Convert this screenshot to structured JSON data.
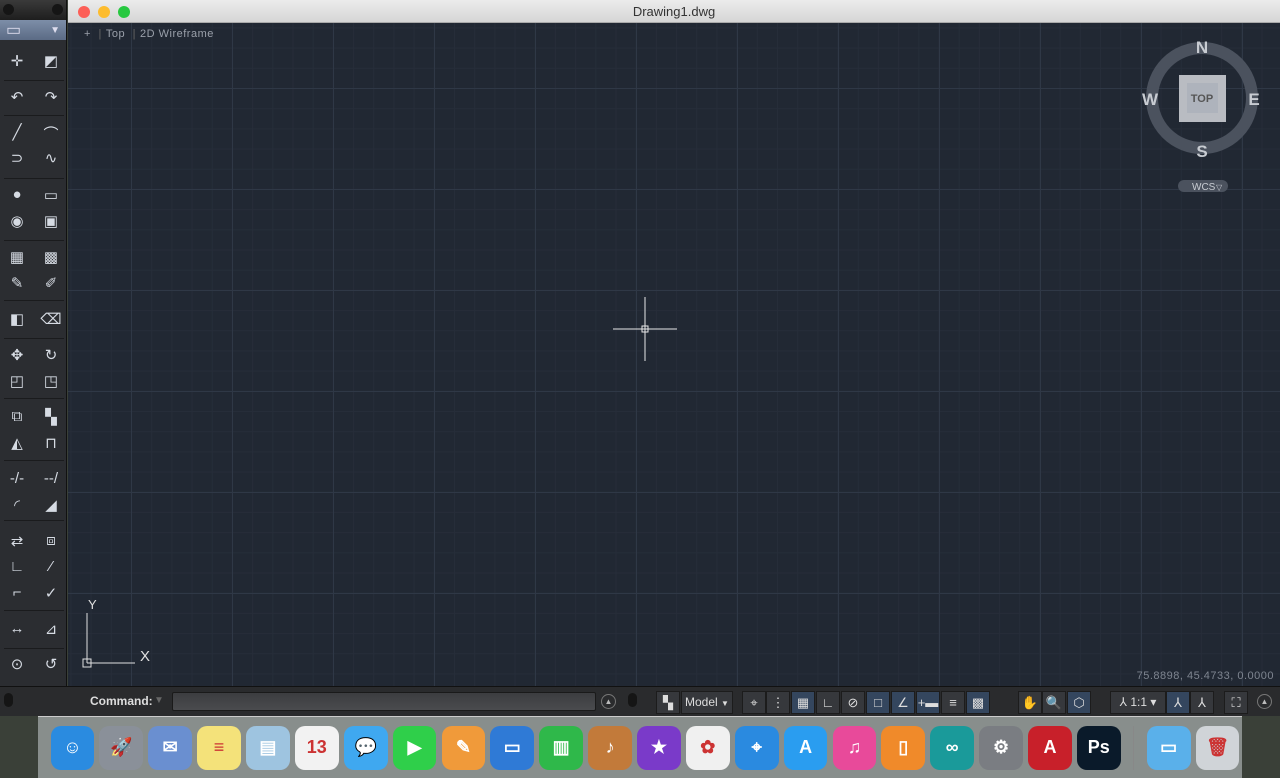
{
  "window": {
    "title": "Drawing1.dwg"
  },
  "viewport": {
    "plus": "+",
    "view": "Top",
    "style": "2D Wireframe",
    "coordinates": "75.8898,  45.4733, 0.0000"
  },
  "viewcube": {
    "n": "N",
    "s": "S",
    "e": "E",
    "w": "W",
    "face": "TOP",
    "ucs": "WCS"
  },
  "ucs_icon": {
    "x": "X",
    "y": "Y"
  },
  "toolbar": {
    "rows": [
      [
        "crosshair-point-icon",
        "✛",
        "region-icon",
        "◩"
      ],
      [
        "undo-icon",
        "↶",
        "redo-icon",
        "↷"
      ],
      [
        "line-icon",
        "╱",
        "arc-icon",
        "⌒"
      ],
      [
        "polyline-icon",
        "⊃",
        "spline-icon",
        "∿"
      ],
      [
        "circle-icon",
        "●",
        "rectangle-icon",
        "▭"
      ],
      [
        "ellipse-icon",
        "◉",
        "boundary-icon",
        "▣"
      ],
      [
        "hatch-icon",
        "▦",
        "gradient-icon",
        "▩"
      ],
      [
        "pen-icon",
        "✎",
        "brush-icon",
        "✐"
      ],
      [
        "block-icon",
        "◧",
        "erase-icon",
        "⌫"
      ],
      [
        "move-icon",
        "✥",
        "rotate-icon",
        "↻"
      ],
      [
        "scale-icon",
        "◰",
        "stretch-icon",
        "◳"
      ],
      [
        "copy-icon",
        "⧉",
        "array-icon",
        "▚"
      ],
      [
        "mirror-icon",
        "◭",
        "offset-icon",
        "⊓"
      ],
      [
        "trim-icon",
        "-/-",
        "extend-icon",
        "--/"
      ],
      [
        "fillet-icon",
        "◜",
        "chamfer-icon",
        "◢"
      ],
      [
        "explode-icon",
        "⇄",
        "join-icon",
        "⧈"
      ],
      [
        "break-icon",
        "∟",
        "lengthen-icon",
        "⁄"
      ],
      [
        "align-icon",
        "⌐",
        "properties-icon",
        "✓"
      ],
      [
        "dimension-icon",
        "↔",
        "leader-icon",
        "⊿"
      ],
      [
        "measure-icon",
        "⊙",
        "inquiry-icon",
        "↺"
      ]
    ]
  },
  "status": {
    "command_label": "Command:",
    "command_value": "",
    "model_label": "Model",
    "scale_label": "1:1"
  },
  "dock": [
    {
      "name": "finder",
      "color": "#2a8be0",
      "glyph": "☺"
    },
    {
      "name": "launchpad",
      "color": "#8a9099",
      "glyph": "🚀"
    },
    {
      "name": "mail",
      "color": "#6a8fd0",
      "glyph": "✉"
    },
    {
      "name": "notes",
      "color": "#f4e27a",
      "glyph": "≡"
    },
    {
      "name": "preview",
      "color": "#9ec4e0",
      "glyph": "▤"
    },
    {
      "name": "calendar",
      "color": "#f2f2f2",
      "glyph": "13"
    },
    {
      "name": "messages",
      "color": "#3fa8f0",
      "glyph": "💬"
    },
    {
      "name": "facetime",
      "color": "#2fcf4a",
      "glyph": "▶"
    },
    {
      "name": "pages",
      "color": "#f09a3a",
      "glyph": "✎"
    },
    {
      "name": "keynote",
      "color": "#2f7ad6",
      "glyph": "▭"
    },
    {
      "name": "numbers",
      "color": "#2fb84a",
      "glyph": "▥"
    },
    {
      "name": "garageband",
      "color": "#c27a3a",
      "glyph": "♪"
    },
    {
      "name": "imovie",
      "color": "#7a3ac9",
      "glyph": "★"
    },
    {
      "name": "photos",
      "color": "#f0f0f0",
      "glyph": "✿"
    },
    {
      "name": "safari",
      "color": "#2a8ae0",
      "glyph": "⌖"
    },
    {
      "name": "app-store",
      "color": "#2a9df0",
      "glyph": "A"
    },
    {
      "name": "itunes",
      "color": "#e84a9a",
      "glyph": "♫"
    },
    {
      "name": "ibooks",
      "color": "#f08a2a",
      "glyph": "▯"
    },
    {
      "name": "arduino",
      "color": "#1a9a9a",
      "glyph": "∞"
    },
    {
      "name": "system-preferences",
      "color": "#7a7d82",
      "glyph": "⚙"
    },
    {
      "name": "autocad",
      "color": "#c8202a",
      "glyph": "A"
    },
    {
      "name": "photoshop",
      "color": "#0a1a2a",
      "glyph": "Ps"
    },
    {
      "name": "downloads-folder",
      "color": "#5ab0ea",
      "glyph": "▭"
    },
    {
      "name": "trash",
      "color": "#d0d4d8",
      "glyph": "🗑"
    }
  ]
}
